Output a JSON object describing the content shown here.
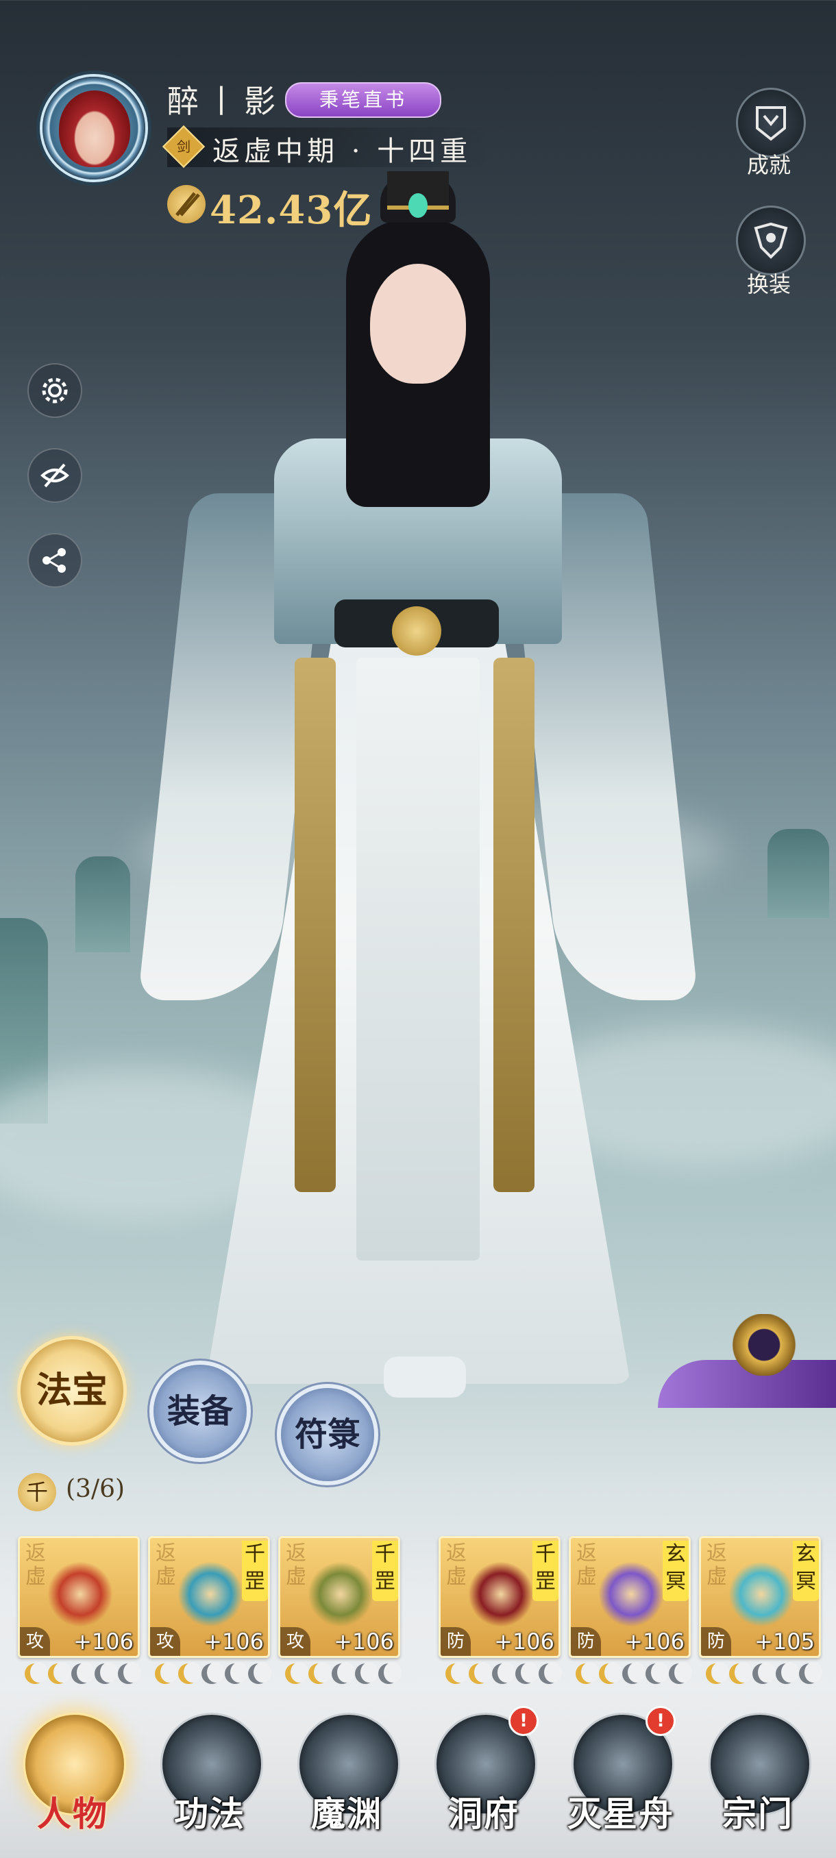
{
  "player": {
    "name": "醉丨影",
    "title_badge": "秉笔直书",
    "sect_tag": "剑",
    "realm": "返虚中期 · 十四重",
    "power": "42.43亿"
  },
  "side_buttons": [
    {
      "label": "成就",
      "icon": "achievement-icon"
    },
    {
      "label": "换装",
      "icon": "wardrobe-icon"
    }
  ],
  "tool_buttons": [
    "settings-icon",
    "hide-ui-eye-icon",
    "share-icon"
  ],
  "equipment_tabs": [
    {
      "label": "法宝",
      "active": true
    },
    {
      "label": "装备",
      "active": false
    },
    {
      "label": "符箓",
      "active": false
    }
  ],
  "set_bonus": {
    "icon_text": "千",
    "count": "(3/6)"
  },
  "items": [
    {
      "ghost": "返虚",
      "flag": "",
      "type": "攻",
      "level": "+106",
      "pips_on": 2,
      "art_color": "#c4402a"
    },
    {
      "ghost": "返虚",
      "flag": "千罡",
      "type": "攻",
      "level": "+106",
      "pips_on": 2,
      "art_color": "#3a9db8"
    },
    {
      "ghost": "返虚",
      "flag": "千罡",
      "type": "攻",
      "level": "+106",
      "pips_on": 2,
      "art_color": "#7c8a3a"
    },
    {
      "ghost": "返虚",
      "flag": "千罡",
      "type": "防",
      "level": "+106",
      "pips_on": 2,
      "art_color": "#8a1e24"
    },
    {
      "ghost": "返虚",
      "flag": "玄冥",
      "type": "防",
      "level": "+106",
      "pips_on": 2,
      "art_color": "#7d58c8"
    },
    {
      "ghost": "返虚",
      "flag": "玄冥",
      "type": "防",
      "level": "+105",
      "pips_on": 2,
      "art_color": "#4fb8c8"
    }
  ],
  "nav": [
    {
      "label": "人物",
      "active": true,
      "alert": ""
    },
    {
      "label": "功法",
      "active": false,
      "alert": ""
    },
    {
      "label": "魔渊",
      "active": false,
      "alert": ""
    },
    {
      "label": "洞府",
      "active": false,
      "alert": "!"
    },
    {
      "label": "灭星舟",
      "active": false,
      "alert": "!"
    },
    {
      "label": "宗门",
      "active": false,
      "alert": ""
    }
  ],
  "colors": {
    "accent_gold": "#f1cf7c",
    "badge_purple": "#8a44c4",
    "nav_active_red": "#d42c2c"
  }
}
